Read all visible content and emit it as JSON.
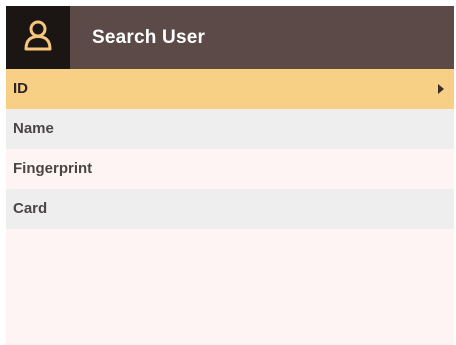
{
  "header": {
    "title": "Search User",
    "icon": "user-icon"
  },
  "menu": {
    "items": [
      {
        "label": "ID",
        "selected": true,
        "icon": "chevron-right-icon"
      },
      {
        "label": "Name",
        "selected": false
      },
      {
        "label": "Fingerprint",
        "selected": false
      },
      {
        "label": "Card",
        "selected": false
      }
    ]
  },
  "colors": {
    "header_bg": "#5c4a48",
    "icon_box_bg": "#1b1614",
    "accent_icon": "#f5c77e",
    "selected_bg": "#f7cf85",
    "alt_row_bg": "#eeeeee",
    "screen_bg": "#fdf4f3"
  }
}
